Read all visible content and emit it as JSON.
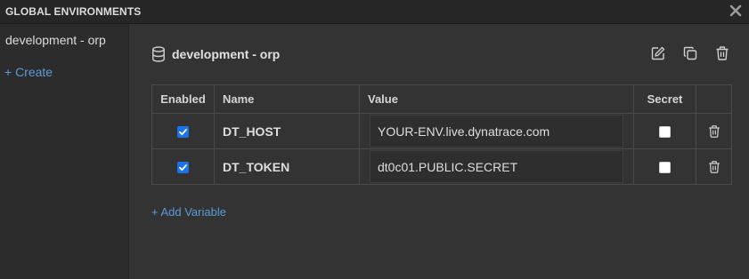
{
  "window": {
    "title": "GLOBAL ENVIRONMENTS"
  },
  "sidebar": {
    "items": [
      {
        "label": "development - orp"
      }
    ],
    "create_label": "+ Create"
  },
  "environment": {
    "name": "development - orp"
  },
  "table": {
    "headers": {
      "enabled": "Enabled",
      "name": "Name",
      "value": "Value",
      "secret": "Secret"
    },
    "rows": [
      {
        "enabled": true,
        "name": "DT_HOST",
        "value": "YOUR-ENV.live.dynatrace.com",
        "secret": false
      },
      {
        "enabled": true,
        "name": "DT_TOKEN",
        "value": "dt0c01.PUBLIC.SECRET",
        "secret": false
      }
    ]
  },
  "add_variable_label": "+ Add Variable",
  "colors": {
    "accent": "#5c9bd6",
    "checkbox": "#1a73e8",
    "background": "#333333",
    "sidebar": "#2c2c2c"
  }
}
